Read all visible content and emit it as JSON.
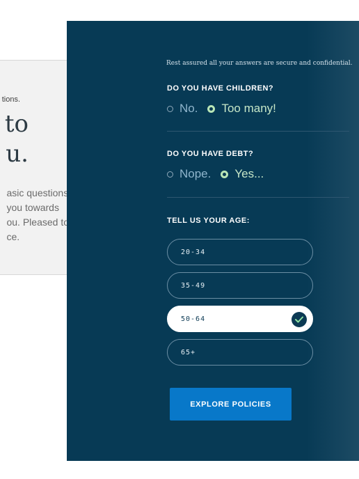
{
  "intro_card": {
    "eyebrow": "tions.",
    "headline_line1": "to",
    "headline_line2": "u.",
    "body_lines": [
      "asic questions",
      "you towards",
      "ou. Pleased to",
      "ce."
    ]
  },
  "security_note": "Rest assured all your answers are secure and confidential.",
  "children_question": {
    "label": "DO YOU HAVE CHILDREN?",
    "options": [
      {
        "label": "No.",
        "selected": false
      },
      {
        "label": "Too many!",
        "selected": true
      }
    ]
  },
  "debt_question": {
    "label": "DO YOU HAVE DEBT?",
    "options": [
      {
        "label": "Nope.",
        "selected": false
      },
      {
        "label": "Yes...",
        "selected": true
      }
    ]
  },
  "age_question": {
    "label": "TELL US YOUR AGE:",
    "options": [
      {
        "label": "20-34",
        "selected": false
      },
      {
        "label": "35-49",
        "selected": false
      },
      {
        "label": "50-64",
        "selected": true
      },
      {
        "label": "65+",
        "selected": false
      }
    ]
  },
  "cta_label": "EXPLORE POLICIES",
  "colors": {
    "panel": "#073a55",
    "accent": "#0878c9",
    "selected_radio": "#b9e6b6",
    "card": "#f2f2f2"
  },
  "icons": {
    "selected_check": "check-icon"
  }
}
